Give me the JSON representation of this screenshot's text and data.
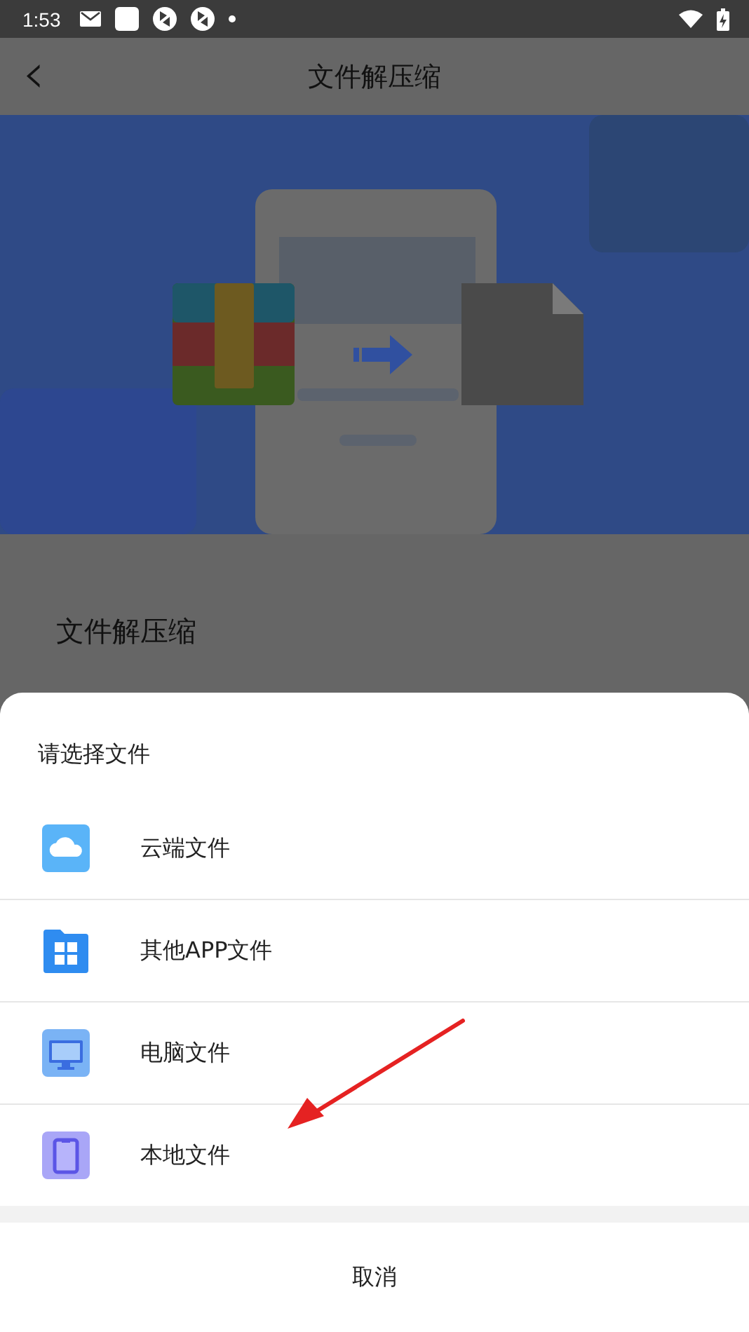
{
  "status_bar": {
    "time": "1:53"
  },
  "header": {
    "back": "‹",
    "title": "文件解压缩"
  },
  "section_title": "文件解压缩",
  "sheet": {
    "title": "请选择文件",
    "options": [
      {
        "label": "云端文件",
        "kind": "cloud"
      },
      {
        "label": "其他APP文件",
        "kind": "apps"
      },
      {
        "label": "电脑文件",
        "kind": "computer"
      },
      {
        "label": "本地文件",
        "kind": "phone"
      }
    ],
    "cancel": "取消"
  }
}
